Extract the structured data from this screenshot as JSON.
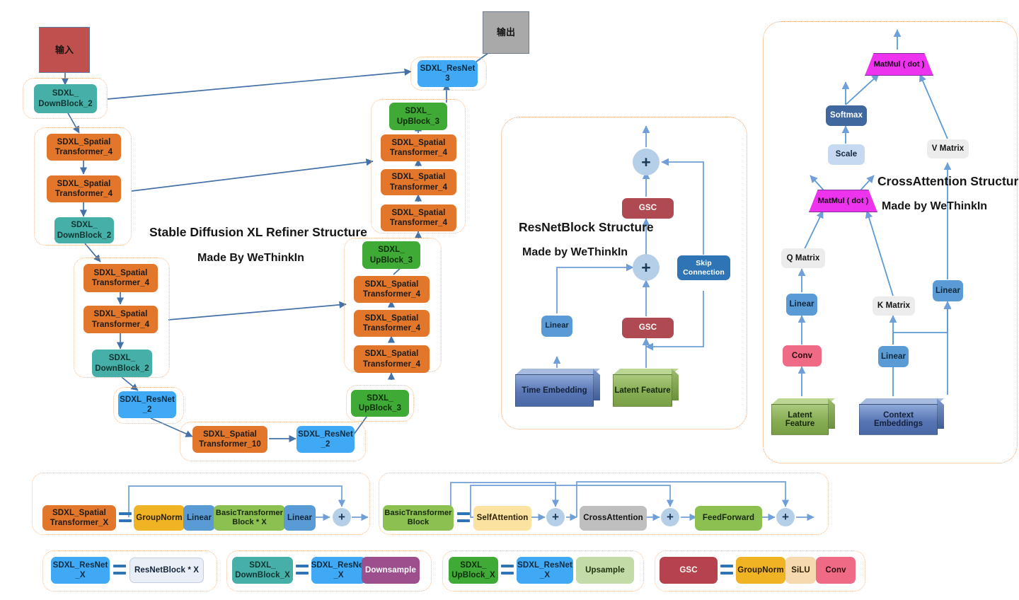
{
  "diagram": {
    "title": "Stable Diffusion XL Refiner Structure",
    "subtitle": "Made By WeThinkIn",
    "input_label": "输入",
    "output_label": "输出"
  },
  "colors": {
    "orange": "#e2762a",
    "teal": "#46b0a8",
    "blue": "#3fa9f5",
    "green": "#3faa35",
    "brick": "#c0504d",
    "grey": "#a9a9a9",
    "magenta": "#ee33ee",
    "accent_frame": "#f6ba86",
    "wire": "#4472a8"
  },
  "main_flow": {
    "down_path": [
      {
        "id": "db2a",
        "label": "SDXL_\nDownBlock_2",
        "kind": "teal"
      },
      {
        "id": "st4a",
        "label": "SDXL_Spatial\nTransformer_4",
        "kind": "orange"
      },
      {
        "id": "st4b",
        "label": "SDXL_Spatial\nTransformer_4",
        "kind": "orange"
      },
      {
        "id": "db2b",
        "label": "SDXL_\nDownBlock_2",
        "kind": "teal"
      },
      {
        "id": "st4c",
        "label": "SDXL_Spatial\nTransformer_4",
        "kind": "orange"
      },
      {
        "id": "st4d",
        "label": "SDXL_Spatial\nTransformer_4",
        "kind": "orange"
      },
      {
        "id": "db2c",
        "label": "SDXL_\nDownBlock_2",
        "kind": "teal"
      },
      {
        "id": "rn2a",
        "label": "SDXL_ResNet\n_2",
        "kind": "blue"
      }
    ],
    "bottleneck": [
      {
        "id": "st10",
        "label": "SDXL_Spatial\nTransformer_10",
        "kind": "orange"
      },
      {
        "id": "rn2b",
        "label": "SDXL_ResNet\n_2",
        "kind": "blue"
      }
    ],
    "up_path": [
      {
        "id": "ub3a",
        "label": "SDXL_\nUpBlock_3",
        "kind": "green"
      },
      {
        "id": "ust4a",
        "label": "SDXL_Spatial\nTransformer_4",
        "kind": "orange"
      },
      {
        "id": "ust4b",
        "label": "SDXL_Spatial\nTransformer_4",
        "kind": "orange"
      },
      {
        "id": "ust4c",
        "label": "SDXL_Spatial\nTransformer_4",
        "kind": "orange"
      },
      {
        "id": "ub3b",
        "label": "SDXL_\nUpBlock_3",
        "kind": "green"
      },
      {
        "id": "ust4d",
        "label": "SDXL_Spatial\nTransformer_4",
        "kind": "orange"
      },
      {
        "id": "ust4e",
        "label": "SDXL_Spatial\nTransformer_4",
        "kind": "orange"
      },
      {
        "id": "ust4f",
        "label": "SDXL_Spatial\nTransformer_4",
        "kind": "orange"
      },
      {
        "id": "ub3c",
        "label": "SDXL_\nUpBlock_3",
        "kind": "green"
      },
      {
        "id": "rn3",
        "label": "SDXL_ResNet\n3",
        "kind": "blue"
      }
    ]
  },
  "resnet_panel": {
    "title": "ResNetBlock Structure",
    "subtitle": "Made by WeThinkIn",
    "nodes": {
      "time_embedding": "Time Embedding",
      "latent_feature": "Latent Feature",
      "linear": "Linear",
      "gsc_lower": "GSC",
      "gsc_upper": "GSC",
      "skip_connection": "Skip\nConnection",
      "add_lower": "+",
      "add_upper": "+"
    }
  },
  "crossattn_panel": {
    "title": "CrossAttention Structure",
    "subtitle": "Made by WeThinkIn",
    "nodes": {
      "matmul_top": "MatMul ( dot )",
      "matmul_bottom": "MatMul ( dot )",
      "softmax": "Softmax",
      "scale": "Scale",
      "q_matrix": "Q Matrix",
      "k_matrix": "K Matrix",
      "v_matrix": "V Matrix",
      "linear_q": "Linear",
      "linear_k": "Linear",
      "linear_v": "Linear",
      "conv": "Conv",
      "latent_feature": "Latent Feature",
      "context_embeddings": "Context Embeddings"
    }
  },
  "legend_spatial_transformer": {
    "lhs": "SDXL_Spatial\nTransformer_X",
    "items": [
      "GroupNorm",
      "Linear",
      "BasicTransformer\nBlock * X",
      "Linear"
    ],
    "add": "+"
  },
  "legend_basic_transformer": {
    "lhs": "BasicTransformer\nBlock",
    "items": [
      "SelfAttention",
      "CrossAttention",
      "FeedForward"
    ],
    "add1": "+",
    "add2": "+",
    "add3": "+"
  },
  "legend_rows": [
    {
      "name": "resnet",
      "lhs": "SDXL_ResNet\n_X",
      "rhs": [
        "ResNetBlock * X"
      ]
    },
    {
      "name": "downblock",
      "lhs": "SDXL_\nDownBlock_X",
      "rhs": [
        "SDXL_ResNet\n_X",
        "Downsample"
      ]
    },
    {
      "name": "upblock",
      "lhs": "SDXL_\nUpBlock_X",
      "rhs": [
        "SDXL_ResNet\n_X",
        "Upsample"
      ]
    },
    {
      "name": "gsc",
      "lhs": "GSC",
      "rhs": [
        "GroupNorm",
        "SiLU",
        "Conv"
      ]
    }
  ]
}
